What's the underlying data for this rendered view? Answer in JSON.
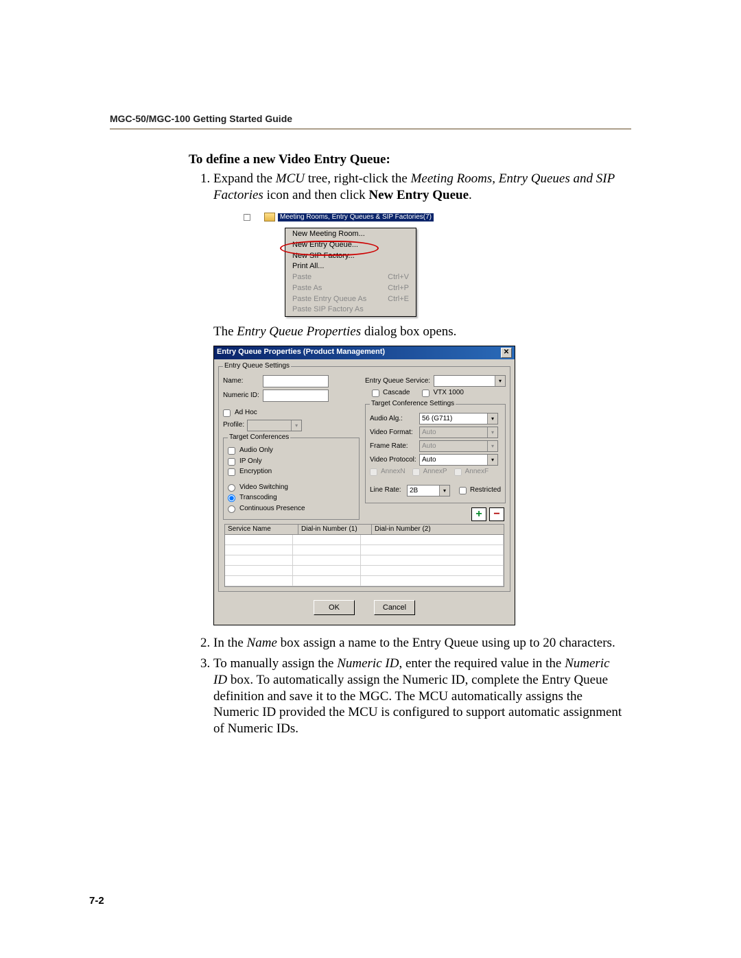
{
  "header": "MGC-50/MGC-100 Getting Started Guide",
  "section_title": "To define a new Video Entry Queue:",
  "step1": {
    "a": "Expand the ",
    "b": "MCU",
    "c": " tree, right-click the ",
    "d": "Meeting Rooms, Entry Queues and SIP Factories",
    "e": " icon and then click ",
    "f": "New Entry Queue",
    "g": "."
  },
  "tree_label": "Meeting Rooms, Entry Queues & SIP Factories(7)",
  "ctx": {
    "items": [
      {
        "label": "New Meeting Room...",
        "enabled": true,
        "short": ""
      },
      {
        "label": "New Entry Queue...",
        "enabled": true,
        "short": ""
      },
      {
        "label": "New SIP Factory...",
        "enabled": true,
        "short": ""
      },
      {
        "label": "Print All...",
        "enabled": true,
        "short": ""
      },
      {
        "label": "Paste",
        "enabled": false,
        "short": "Ctrl+V"
      },
      {
        "label": "Paste As",
        "enabled": false,
        "short": "Ctrl+P"
      },
      {
        "label": "Paste Entry Queue As",
        "enabled": false,
        "short": "Ctrl+E"
      },
      {
        "label": "Paste SIP Factory As",
        "enabled": false,
        "short": ""
      }
    ]
  },
  "caption": {
    "a": "The ",
    "b": "Entry Queue Properties",
    "c": " dialog box opens."
  },
  "dlg": {
    "title": "Entry Queue Properties (Product Management)",
    "close": "✕",
    "fs_settings": "Entry Queue Settings",
    "name_lbl": "Name:",
    "numid_lbl": "Numeric ID:",
    "eqservice_lbl": "Entry Queue Service:",
    "cascade_lbl": "Cascade",
    "vtx_lbl": "VTX 1000",
    "adhoc_lbl": "Ad Hoc",
    "profile_lbl": "Profile:",
    "fs_target": "Target Conferences",
    "audio_only": "Audio Only",
    "ip_only": "IP Only",
    "encryption": "Encryption",
    "vs": "Video Switching",
    "tc": "Transcoding",
    "cp": "Continuous Presence",
    "fs_tcs": "Target Conference Settings",
    "audio_alg_lbl": "Audio Alg.:",
    "audio_alg_val": "56 (G711)",
    "vf_lbl": "Video Format:",
    "vf_val": "Auto",
    "fr_lbl": "Frame Rate:",
    "fr_val": "Auto",
    "vp_lbl": "Video Protocol:",
    "vp_val": "Auto",
    "annexN": "AnnexN",
    "annexP": "AnnexP",
    "annexF": "AnnexF",
    "line_rate_lbl": "Line Rate:",
    "line_rate_val": "2B",
    "restricted": "Restricted",
    "grid_h1": "Service Name",
    "grid_h2": "Dial-in Number (1)",
    "grid_h3": "Dial-in Number (2)",
    "ok": "OK",
    "cancel": "Cancel"
  },
  "step2": {
    "a": "In the ",
    "b": "Name",
    "c": " box assign a name to the Entry Queue using up to 20 characters."
  },
  "step3": {
    "a": "To manually assign the ",
    "b": "Numeric ID",
    "c": ", enter the required value in the ",
    "d": "Numeric ID",
    "e": " box. To automatically assign the Numeric ID, complete the Entry Queue definition and save it to the MGC. The MCU automatically assigns the Numeric ID provided the MCU is configured to support automatic assignment of Numeric IDs."
  },
  "page_num": "7-2"
}
